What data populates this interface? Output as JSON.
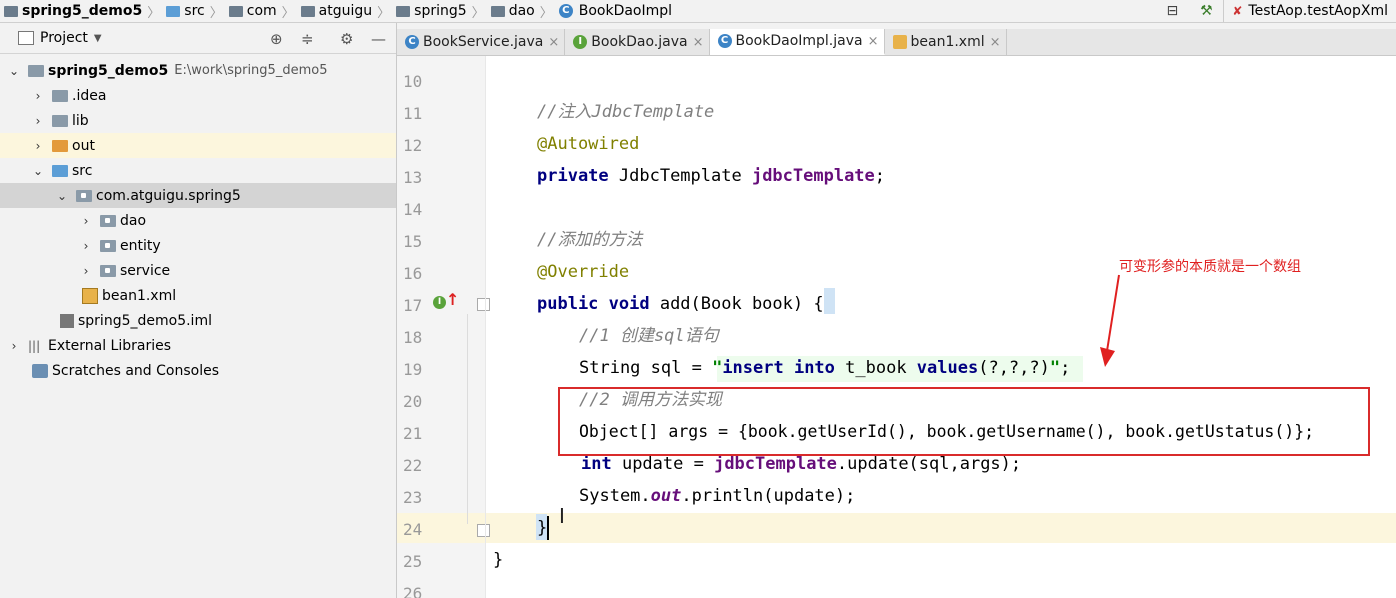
{
  "breadcrumb": {
    "items": [
      "spring5_demo5",
      "src",
      "com",
      "atguigu",
      "spring5",
      "dao",
      "BookDaoImpl"
    ]
  },
  "run_config": {
    "label": "TestAop.testAopXml"
  },
  "project_panel": {
    "title": "Project",
    "tree": [
      {
        "label": "spring5_demo5",
        "path": "E:\\work\\spring5_demo5"
      },
      {
        "label": ".idea"
      },
      {
        "label": "lib"
      },
      {
        "label": "out"
      },
      {
        "label": "src"
      },
      {
        "label": "com.atguigu.spring5"
      },
      {
        "label": "dao"
      },
      {
        "label": "entity"
      },
      {
        "label": "service"
      },
      {
        "label": "bean1.xml"
      },
      {
        "label": "spring5_demo5.iml"
      },
      {
        "label": "External Libraries"
      },
      {
        "label": "Scratches and Consoles"
      }
    ]
  },
  "tabs": [
    {
      "label": "BookService.java",
      "icon": "class-icon"
    },
    {
      "label": "BookDao.java",
      "icon": "interface-icon"
    },
    {
      "label": "BookDaoImpl.java",
      "icon": "class-icon",
      "active": true
    },
    {
      "label": "bean1.xml",
      "icon": "xml-icon"
    }
  ],
  "editor": {
    "line_numbers": [
      "10",
      "11",
      "12",
      "13",
      "14",
      "15",
      "16",
      "17",
      "18",
      "19",
      "20",
      "21",
      "22",
      "23",
      "24",
      "25",
      "26"
    ],
    "lines": {
      "l11_comment": "//注入JdbcTemplate",
      "l12_annotation": "@Autowired",
      "l13_kw": "private",
      "l13_type": " JdbcTemplate ",
      "l13_field": "jdbcTemplate",
      "l13_end": ";",
      "l15_comment": "//添加的方法",
      "l16_annotation": "@Override",
      "l17_kw": "public void",
      "l17_rest": " add(Book book) ",
      "l17_brace": "{",
      "l18_comment": "//1 创建sql语句",
      "l19_a": "String sql = ",
      "l19_q1": "\"",
      "l19_kw1": "insert into",
      "l19_mid": " t_book ",
      "l19_kw2": "values",
      "l19_args": "(?,?,?)",
      "l19_q2": "\"",
      "l19_end": ";",
      "l20_comment": "//2 调用方法实现",
      "l21_code": "Object[] args = {book.getUserId(), book.getUsername(), book.getUstatus()};",
      "l22_kw": "int",
      "l22_a": " update = ",
      "l22_field": "jdbcTemplate",
      "l22_rest": ".update(sql,args);",
      "l23_a": "System.",
      "l23_out": "out",
      "l23_rest": ".println(update);",
      "l24_brace": "}",
      "l25_brace": "}"
    },
    "annotation_note": "可变形参的本质就是一个数组",
    "colors": {
      "annotation_red": "#d92b2b"
    }
  }
}
